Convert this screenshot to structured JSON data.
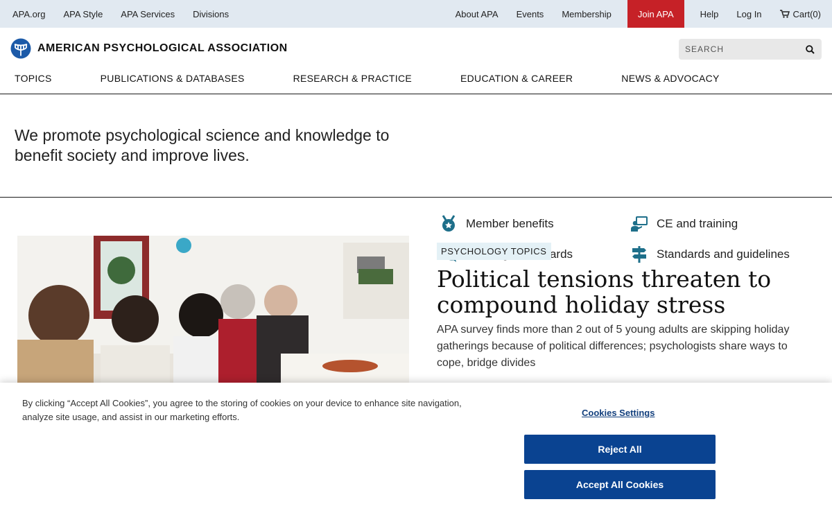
{
  "utility_nav": {
    "left": [
      "APA.org",
      "APA Style",
      "APA Services",
      "Divisions"
    ],
    "about": "About APA",
    "events": "Events",
    "membership": "Membership",
    "join": "Join APA",
    "help": "Help",
    "login": "Log In",
    "cart": "Cart(0)"
  },
  "header": {
    "logo_text": "AMERICAN PSYCHOLOGICAL ASSOCIATION",
    "search_placeholder": "SEARCH"
  },
  "main_nav": [
    "TOPICS",
    "PUBLICATIONS & DATABASES",
    "RESEARCH & PRACTICE",
    "EDUCATION & CAREER",
    "NEWS & ADVOCACY"
  ],
  "mission": {
    "text": "We promote psychological science and knowledge to benefit society and improve lives."
  },
  "quick_links": {
    "member_benefits": "Member benefits",
    "ce_training": "CE and training",
    "funding_awards": "Funding and awards",
    "standards": "Standards and guidelines"
  },
  "feature": {
    "tag": "PSYCHOLOGY TOPICS",
    "headline": "Political tensions threaten to compound holiday stress",
    "dek": "APA survey finds more than 2 out of 5 young adults are skipping holiday gatherings because of political differences; psychologists share ways to cope, bridge divides"
  },
  "cookie_banner": {
    "text": "By clicking “Accept All Cookies”, you agree to the storing of cookies on your device to enhance site navigation, analyze site usage, and assist in our marketing efforts.",
    "settings": "Cookies Settings",
    "reject": "Reject All",
    "accept": "Accept All Cookies"
  },
  "colors": {
    "utility_bg": "#e1e9f1",
    "join_red": "#c62127",
    "brand_blue": "#0a4391",
    "icon_teal": "#1e6f8a",
    "tag_bg": "#e4f1f6"
  }
}
